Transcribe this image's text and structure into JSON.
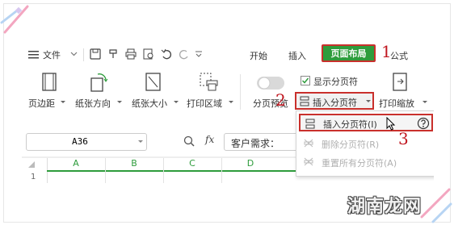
{
  "menu": {
    "label": "文件"
  },
  "tabs": [
    {
      "label": "开始"
    },
    {
      "label": "插入"
    },
    {
      "label": "页面布局"
    },
    {
      "label": "公式"
    }
  ],
  "ribbon": {
    "margins": "页边距",
    "orientation": "纸张方向",
    "size": "纸张大小",
    "print_area": "打印区域",
    "page_break_preview": "分页预览",
    "show_page_breaks": "显示分页符",
    "insert_page_break": "插入分页符",
    "print_scaling": "打印缩放"
  },
  "dropdown": {
    "items": [
      {
        "label": "插入分页符(I)"
      },
      {
        "label": "删除分页符(R)"
      },
      {
        "label": "重置所有分页符(A)"
      }
    ]
  },
  "annotations": {
    "step1": "1",
    "step2": "2",
    "step3": "3"
  },
  "formula_bar": {
    "cell_ref": "A36",
    "fx": "fx",
    "content": "客户需求："
  },
  "sheet": {
    "columns": [
      "A",
      "B",
      "C",
      "D"
    ],
    "row1": "1"
  },
  "watermark": "湖南龙网",
  "colors": {
    "accent": "#2e9c3c",
    "annotation_red": "#c0161f"
  }
}
